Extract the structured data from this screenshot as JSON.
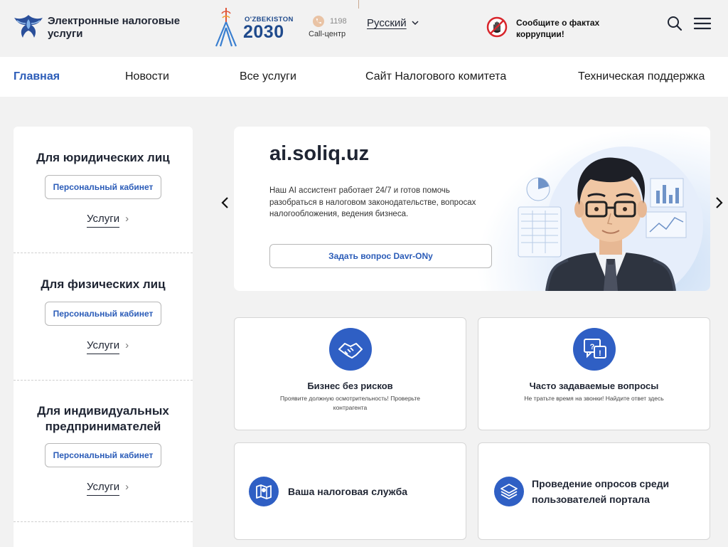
{
  "header": {
    "brand": "Электронные налоговые услуги",
    "uzb_top": "O'ZBEKISTON",
    "uzb_year": "2030",
    "call_number": "1198",
    "call_label": "Call-центр",
    "language": "Русский",
    "corruption_text": "Сообщите о фактах коррупции!"
  },
  "nav": {
    "items": [
      "Главная",
      "Новости",
      "Все услуги",
      "Сайт Налогового комитета",
      "Техническая поддержка"
    ],
    "active": "Главная"
  },
  "left_panel": {
    "sections": [
      {
        "title": "Для юридических лиц",
        "button": "Персональный кабинет",
        "link": "Услуги"
      },
      {
        "title": "Для физических лиц",
        "button": "Персональный кабинет",
        "link": "Услуги"
      },
      {
        "title": "Для индивидуальных предпринимателей",
        "button": "Персональный кабинет",
        "link": "Услуги"
      }
    ]
  },
  "banner": {
    "title": "ai.soliq.uz",
    "text": "Наш AI ассистент работает 24/7 и готов помочь разобраться в налоговом законодательстве, вопросах налогообложения, ведения бизнеса.",
    "button": "Задать вопрос Davr-ONy"
  },
  "cards": [
    {
      "title": "Бизнес без рисков",
      "subtitle": "Проявите должную осмотрительность! Проверьте контрагента",
      "icon": "handshake-icon"
    },
    {
      "title": "Часто задаваемые вопросы",
      "subtitle": "Не тратьте время на звонки! Найдите ответ здесь",
      "icon": "faq-chat-icon"
    },
    {
      "title": "Ваша налоговая служба",
      "icon": "map-icon"
    },
    {
      "title": "Проведение опросов среди пользователей портала",
      "icon": "layers-icon"
    }
  ],
  "colors": {
    "accent": "#2b5cb8",
    "icon_bg": "#2f5fc4",
    "page_bg": "#f2f2f2"
  }
}
